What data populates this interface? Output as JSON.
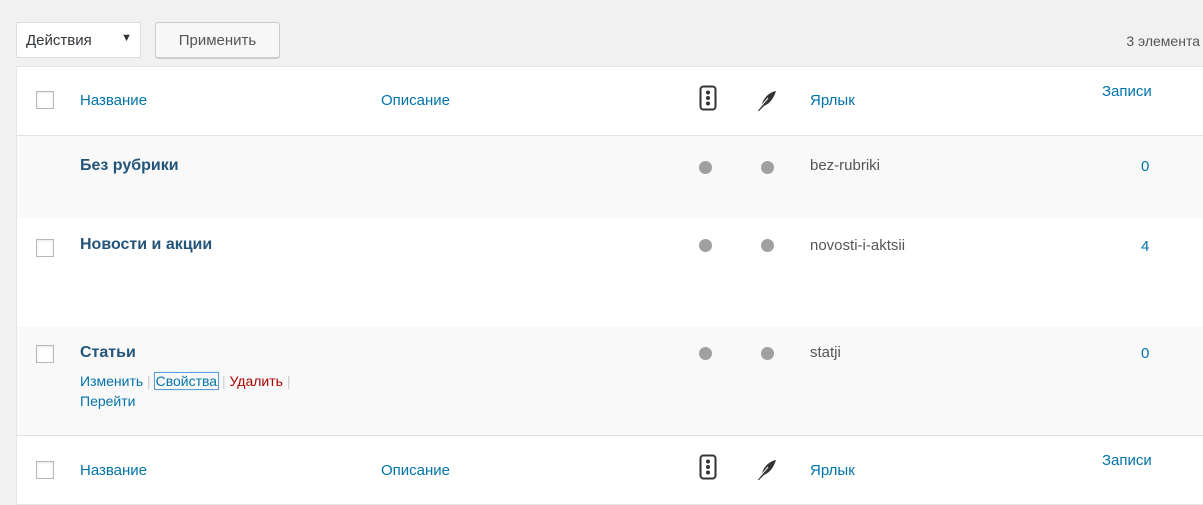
{
  "toolbar": {
    "bulk_actions": "Действия",
    "apply": "Применить",
    "count": "3 элемента"
  },
  "columns": {
    "name": "Название",
    "description": "Описание",
    "slug": "Ярлык",
    "posts": "Записи"
  },
  "rows": [
    {
      "name": "Без рубрики",
      "slug": "bez-rubriki",
      "posts": "0",
      "checkbox": false
    },
    {
      "name": "Новости и акции",
      "slug": "novosti-i-aktsii",
      "posts": "4",
      "checkbox": true
    },
    {
      "name": "Статьи",
      "slug": "statji",
      "posts": "0",
      "checkbox": true
    }
  ],
  "row_actions": {
    "edit": "Изменить",
    "properties": "Свойства",
    "delete": "Удалить",
    "view": "Перейти"
  },
  "icons": {
    "column_icon_1": "traffic-light-icon",
    "column_icon_2": "feather-icon",
    "status_dot_color": "#a0a0a0",
    "link_color": "#0073aa",
    "delete_color": "#aa0000"
  }
}
